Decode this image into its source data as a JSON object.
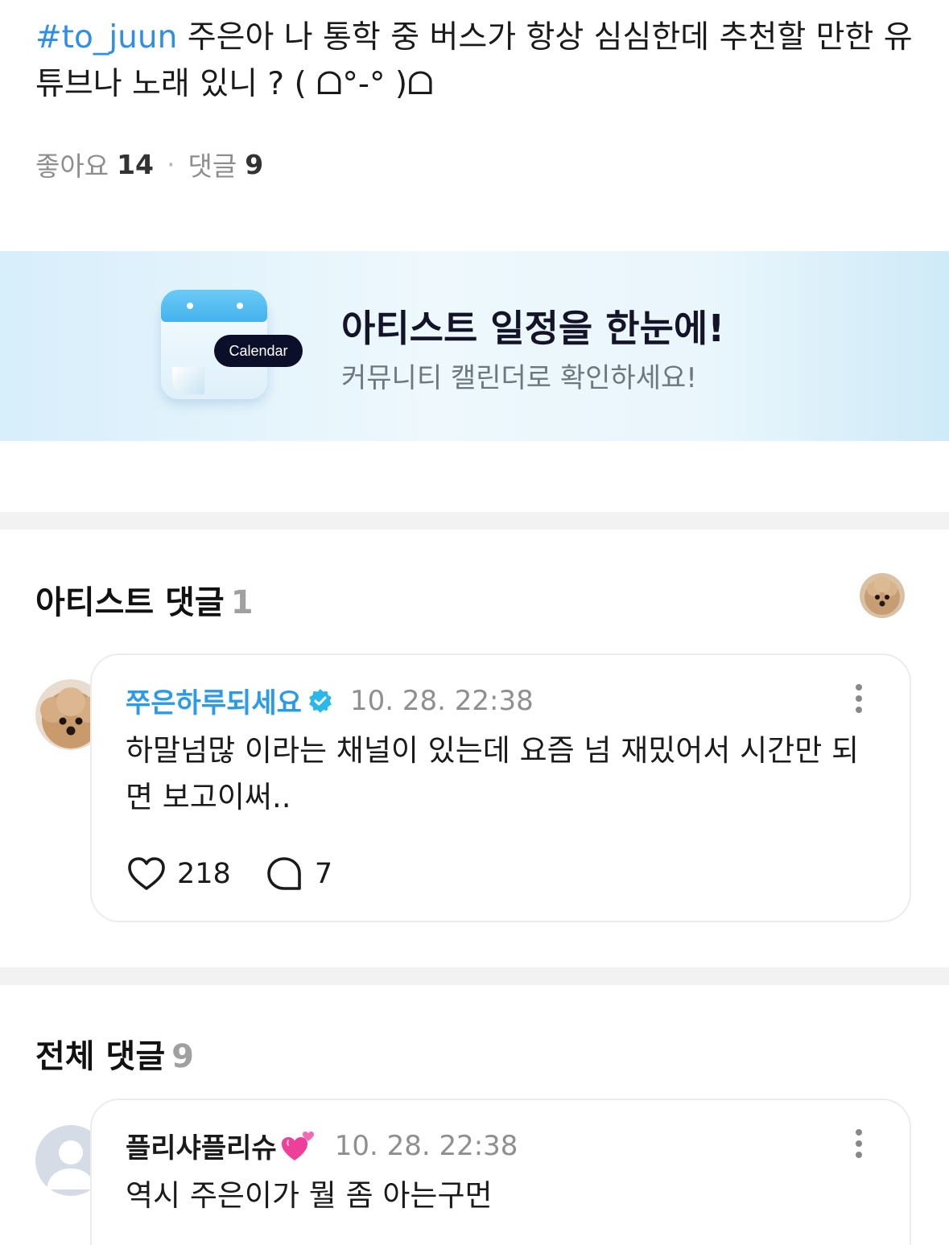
{
  "post": {
    "hashtag": "#to_juun",
    "text": " 주은아 나 통학 중 버스가 항상 심심한데 추천할 만한 유튜브나 노래 있니 ? ( ᗝ°-° )ᗝ",
    "likes_label": "좋아요",
    "likes_count": "14",
    "comments_label": "댓글",
    "comments_count": "9"
  },
  "banner": {
    "icon_label": "Calendar",
    "title": "아티스트 일정을 한눈에!",
    "subtitle": "커뮤니티 캘린더로 확인하세요!"
  },
  "artist_comments": {
    "title": "아티스트 댓글",
    "count": "1",
    "items": [
      {
        "author": "쭈은하루되세요",
        "verified": true,
        "time": "10. 28. 22:38",
        "text": "하말넘많 이라는 채널이 있는데 요즘 넘 재밌어서 시간만 되면 보고이써..",
        "likes": "218",
        "replies": "7"
      }
    ]
  },
  "all_comments": {
    "title": "전체 댓글",
    "count": "9",
    "items": [
      {
        "author": "플리샤플리슈",
        "time": "10. 28. 22:38",
        "text": "역시 주은이가 뭘 좀 아는구먼"
      }
    ]
  },
  "colors": {
    "hashtag": "#2f8fe8",
    "artist_name": "#2b9ae8",
    "verified_badge": "#2bb8e8",
    "divider": "#f2f2f3"
  }
}
